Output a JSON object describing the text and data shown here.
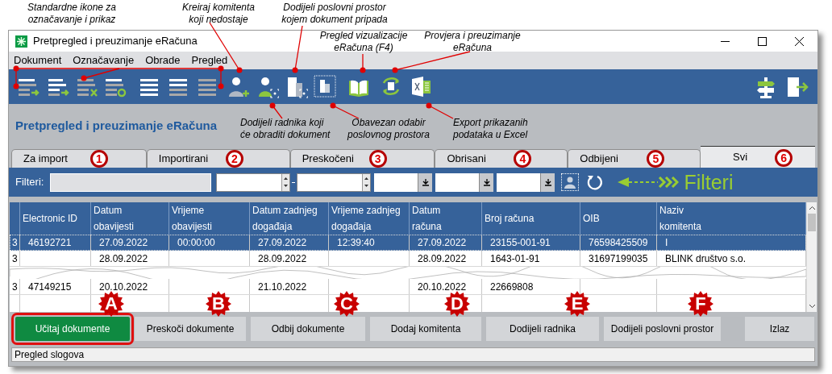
{
  "annotations": [
    {
      "text": "Standardne ikone za\noznačavanje i prikaz"
    },
    {
      "text": "Kreiraj komitenta\nkoji nedostaje"
    },
    {
      "text": "Dodijeli poslovni prostor\nkojem dokument pripada"
    },
    {
      "text": "Pregled vizualizacije\neRačuna (F4)"
    },
    {
      "text": "Provjera i preuzimanje\neRačuna"
    },
    {
      "text": "Dodijeli radnika koji\nće  obraditi dokument"
    },
    {
      "text": "Obavezan odabir\nposlovnog prostora"
    },
    {
      "text": "Export prikazanih\npodataka u Excel"
    }
  ],
  "window": {
    "title": "Pretpregled i preuzimanje eRačuna"
  },
  "menu": [
    {
      "label": "Dokument"
    },
    {
      "label": "Označavanje"
    },
    {
      "label": "Obrade"
    },
    {
      "label": "Pregled"
    }
  ],
  "page_title": "Pretpregled i preuzimanje eRačuna",
  "tabs": [
    {
      "label": "Za import",
      "marker": "1",
      "selected": false
    },
    {
      "label": "Importirani",
      "marker": "2",
      "selected": false
    },
    {
      "label": "Preskočeni",
      "marker": "3",
      "selected": false
    },
    {
      "label": "Obrisani",
      "marker": "4",
      "selected": false
    },
    {
      "label": "Odbijeni",
      "marker": "5",
      "selected": false
    },
    {
      "label": "Svi",
      "marker": "6",
      "selected": true
    }
  ],
  "filters": {
    "label": "Filteri:",
    "annotation": "Filteri"
  },
  "table": {
    "columns": [
      "",
      "Electronic ID",
      "Datum\nobavijesti",
      "Vrijeme\nobavijesti",
      "Datum zadnjeg\ndogađaja",
      "Vrijeme zadnjeg\ndogađaja",
      "Datum\nračuna",
      "Broj računa",
      "OIB",
      "Naziv\nkomitenta"
    ],
    "rows": [
      {
        "selected": true,
        "cells": [
          "3",
          "46192721",
          "27.09.2022",
          "00:00:00",
          "27.09.2022",
          "12:39:40",
          "27.09.2022",
          "23155-001-91",
          "76598425509",
          "I"
        ]
      },
      {
        "selected": false,
        "cells": [
          "3",
          null,
          "28.09.2022",
          null,
          "28.09.2022",
          null,
          "28.09.2022",
          "1643-01-91",
          "31697199035",
          "BLINK društvo s.o."
        ]
      },
      {
        "selected": false,
        "cells": [
          "3",
          "47149215",
          "20.10.2022",
          null,
          "21.10.2022",
          null,
          "20.10.2022",
          "22669808",
          null,
          null
        ]
      }
    ]
  },
  "buttons": [
    {
      "label": "Učitaj dokumente",
      "marker": "A",
      "highlighted": true
    },
    {
      "label": "Preskoči dokumente",
      "marker": "B",
      "highlighted": false
    },
    {
      "label": "Odbij dokumente",
      "marker": "C",
      "highlighted": false
    },
    {
      "label": "Dodaj komitenta",
      "marker": "D",
      "highlighted": false
    },
    {
      "label": "Dodijeli radnika",
      "marker": "E",
      "highlighted": false
    },
    {
      "label": "Dodijeli poslovni prostor",
      "marker": "F",
      "highlighted": false
    },
    {
      "label": "Izlaz",
      "highlighted": false
    }
  ],
  "status_bar": "Pregled slogova"
}
